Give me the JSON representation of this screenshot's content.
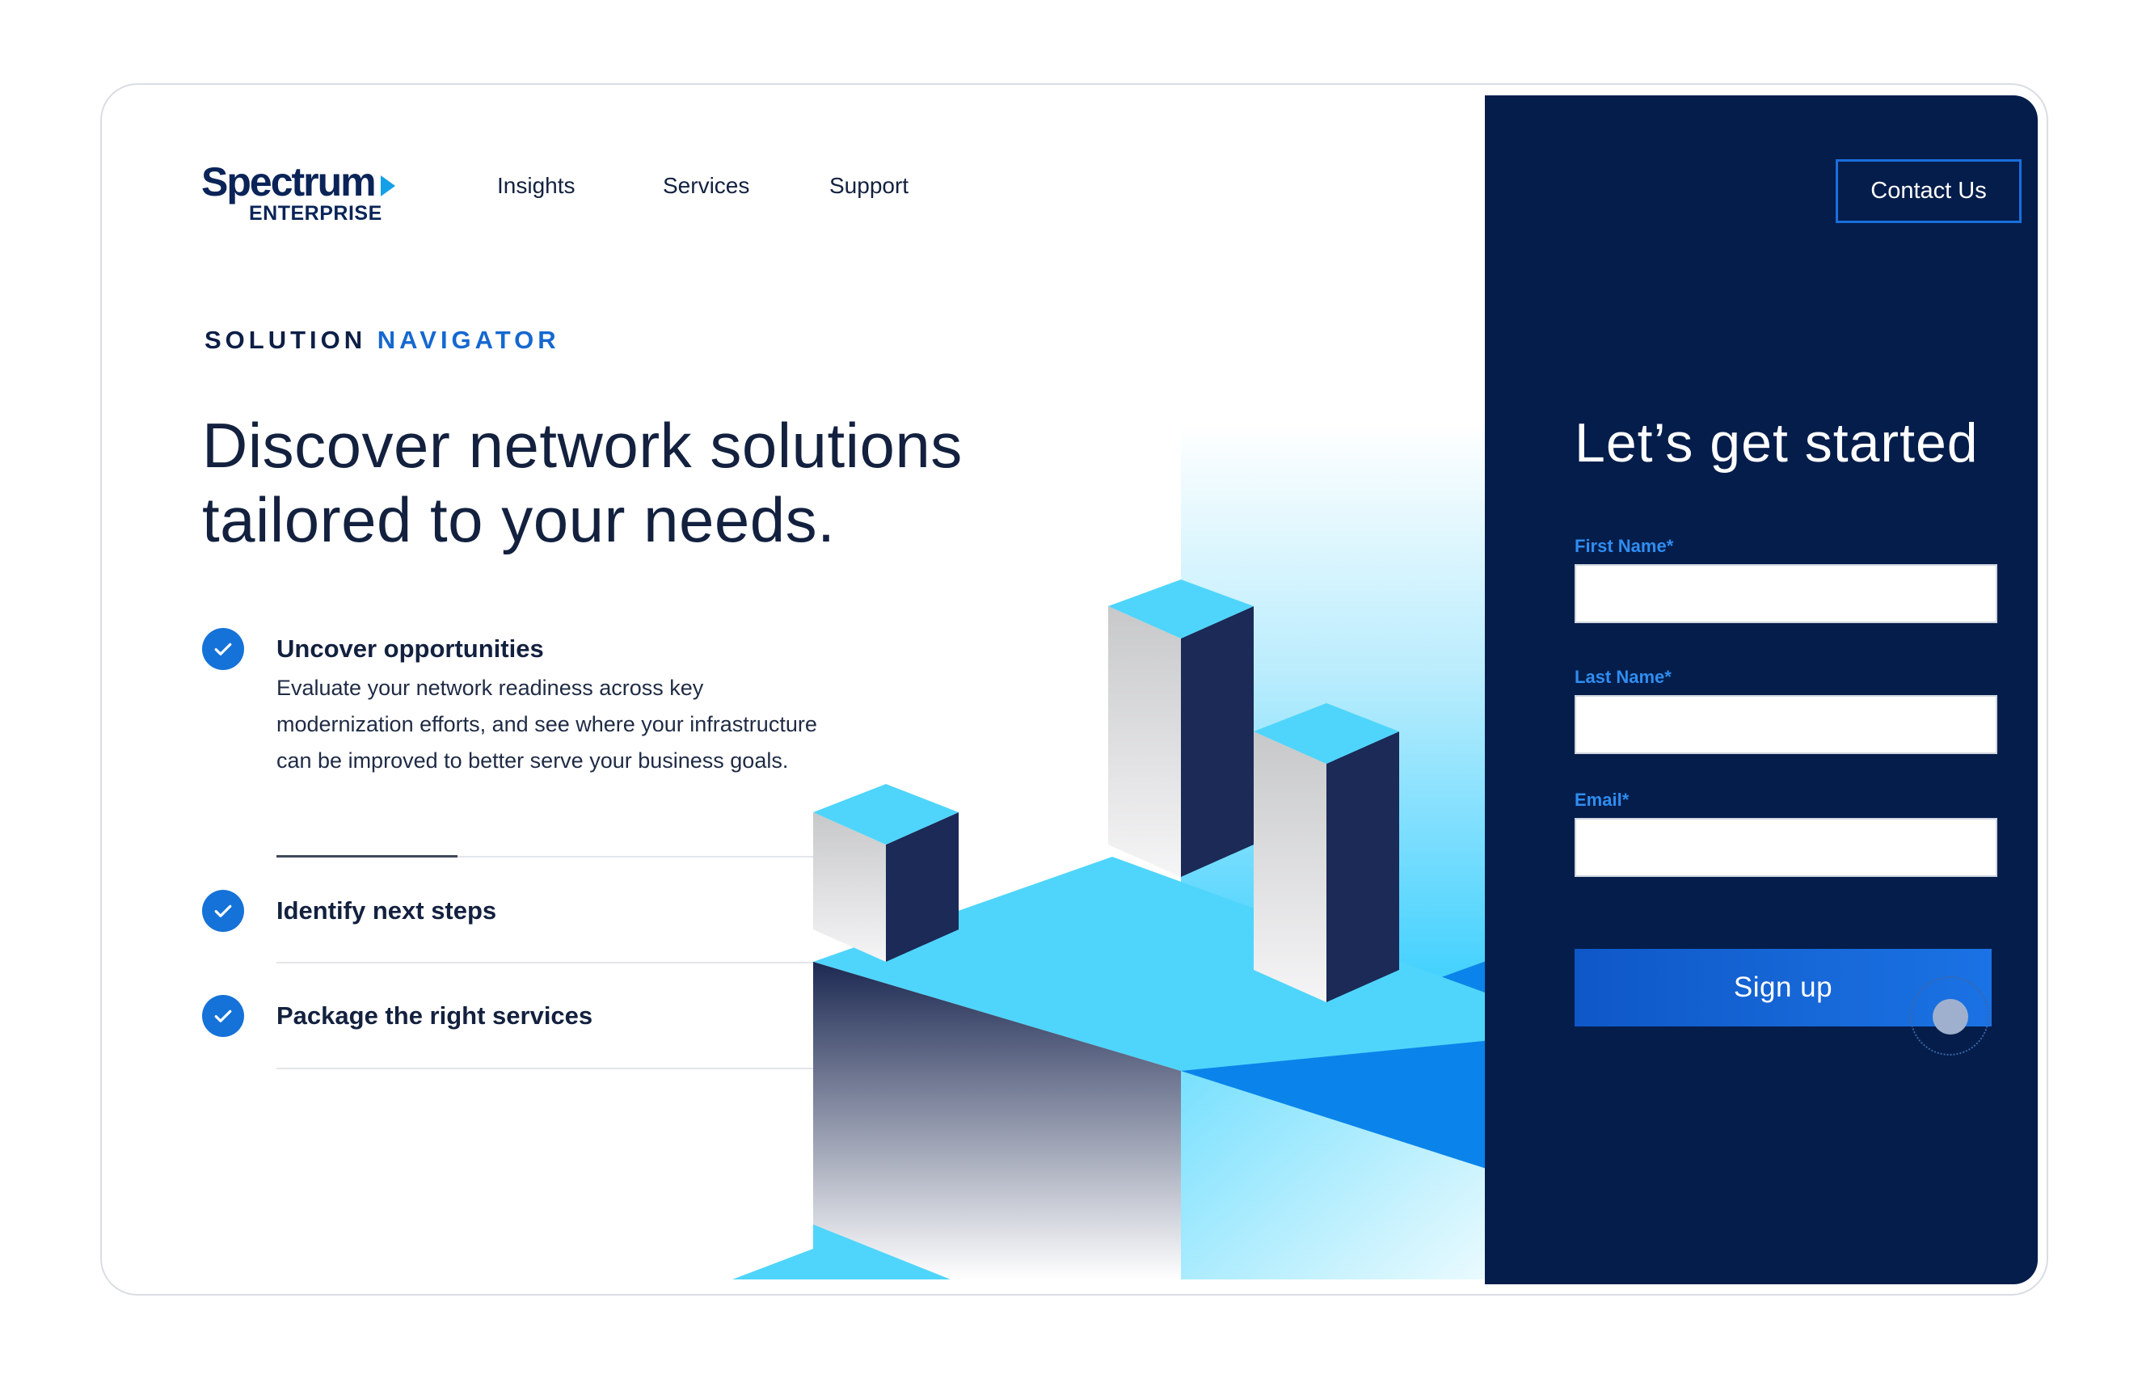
{
  "brand": {
    "name": "Spectrum",
    "sub": "ENTERPRISE"
  },
  "nav": [
    "Insights",
    "Services",
    "Support"
  ],
  "eyebrow": {
    "word1": "SOLUTION",
    "word2": "NAVIGATOR"
  },
  "headline": {
    "line1": "Discover network solutions",
    "line2": "tailored to your needs."
  },
  "features": [
    {
      "title": "Uncover opportunities",
      "body": "Evaluate your network readiness across key modernization efforts, and see where your infrastructure can be improved to better serve your business goals."
    },
    {
      "title": "Identify next steps"
    },
    {
      "title": "Package the right services"
    }
  ],
  "panel": {
    "contact": "Contact Us",
    "title": "Let’s get started",
    "fields": [
      {
        "label": "First Name*",
        "value": ""
      },
      {
        "label": "Last Name*",
        "value": ""
      },
      {
        "label": "Email*",
        "value": ""
      }
    ],
    "submit": "Sign up"
  },
  "colors": {
    "navy": "#041d4b",
    "accent_blue": "#1568d0",
    "cyan": "#4fd5fb",
    "text": "#13213f"
  },
  "icons": [
    "check-icon",
    "logo-arrow-icon",
    "cursor-icon"
  ]
}
